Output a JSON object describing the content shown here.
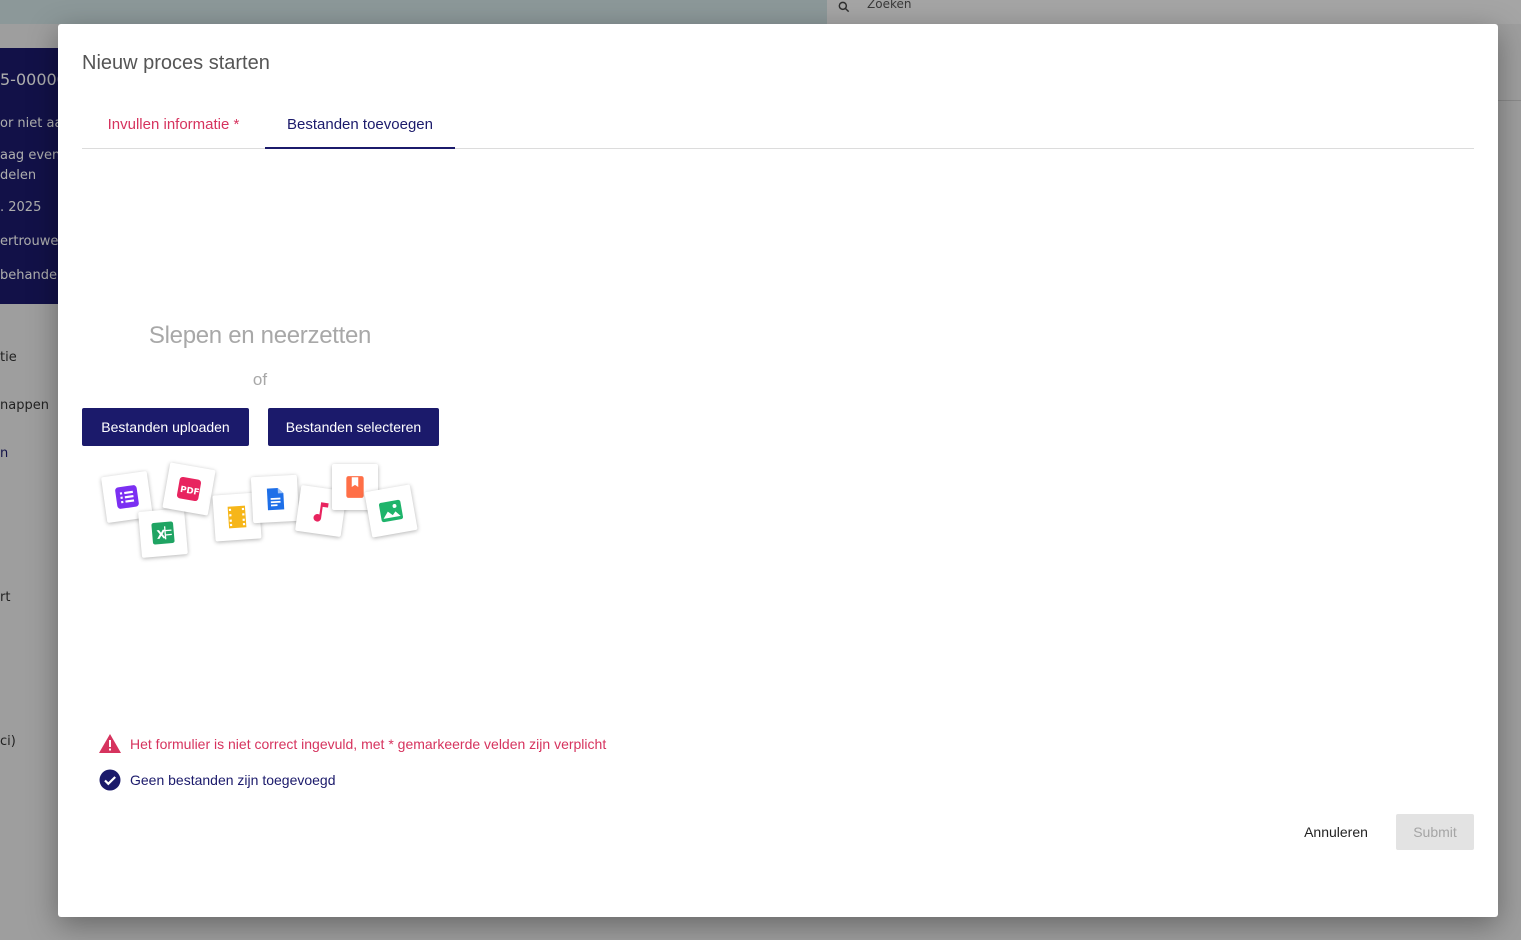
{
  "background": {
    "search_placeholder": "Zoeken",
    "card_lines": [
      "5-00000",
      "or niet aa",
      "aag even",
      "delen",
      ". 2025",
      "ertrouwe",
      "behande"
    ],
    "side_lines": [
      "tie",
      "nappen",
      "n",
      "rt",
      "ci)"
    ]
  },
  "modal": {
    "title": "Nieuw proces starten",
    "tabs": [
      {
        "label": "Invullen informatie *",
        "state": "error"
      },
      {
        "label": "Bestanden toevoegen",
        "state": "active"
      }
    ],
    "dropzone": {
      "title": "Slepen en neerzetten",
      "or": "of",
      "upload_label": "Bestanden uploaden",
      "select_label": "Bestanden selecteren",
      "file_type_icons": [
        "form-icon",
        "spreadsheet-icon",
        "pdf-icon",
        "video-icon",
        "document-icon",
        "music-icon",
        "bookmark-icon",
        "image-icon"
      ]
    },
    "messages": {
      "error": "Het formulier is niet correct ingevuld, met * gemarkeerde velden zijn verplicht",
      "ok": "Geen bestanden zijn toegevoegd"
    },
    "footer": {
      "cancel_label": "Annuleren",
      "submit_label": "Submit"
    }
  },
  "colors": {
    "primary": "#1b1a6b",
    "error": "#d6335e",
    "muted": "#a8a8a8",
    "disabled": "#e3e3e3"
  }
}
